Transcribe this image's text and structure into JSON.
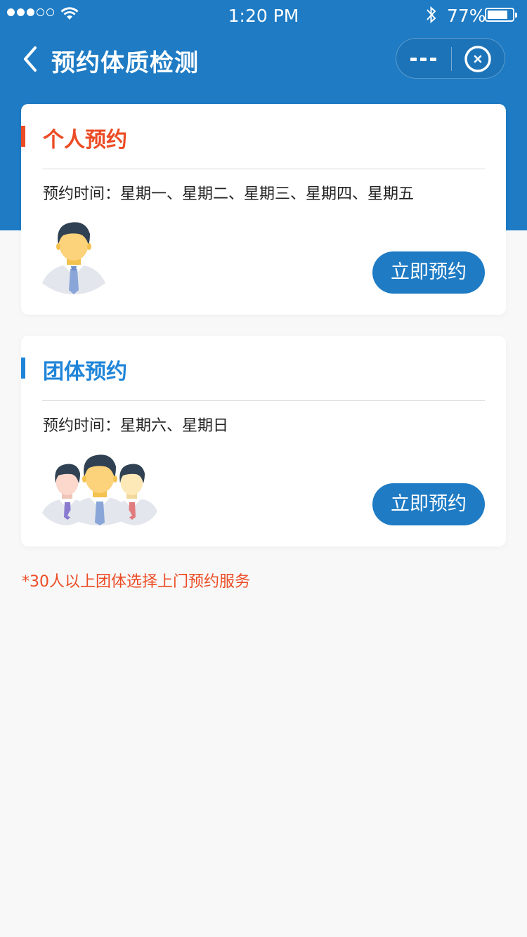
{
  "status_bar": {
    "time": "1:20 PM",
    "battery_percent": "77%",
    "signal_dots_filled": 3,
    "signal_dots_total": 5,
    "battery_level": 0.77
  },
  "nav": {
    "title": "预约体质检测",
    "back_icon": "chevron-left-icon",
    "more_icon": "more-dots-icon",
    "close_icon": "miniprogram-close-icon"
  },
  "cards": [
    {
      "title": "个人预约",
      "accent_color": "#ec4b24",
      "schedule_label": "预约时间：",
      "schedule_value": "星期一、星期二、星期三、星期四、星期五",
      "button_label": "立即预约",
      "illustration": "single-person-avatar"
    },
    {
      "title": "团体预约",
      "accent_color": "#1e84d8",
      "schedule_label": "预约时间：",
      "schedule_value": "星期六、星期日",
      "button_label": "立即预约",
      "illustration": "group-avatar"
    }
  ],
  "notice": "*30人以上团体选择上门预约服务",
  "colors": {
    "primary": "#1e7bc4",
    "warning_text": "#ec4b24",
    "background": "#f8f8f8"
  }
}
